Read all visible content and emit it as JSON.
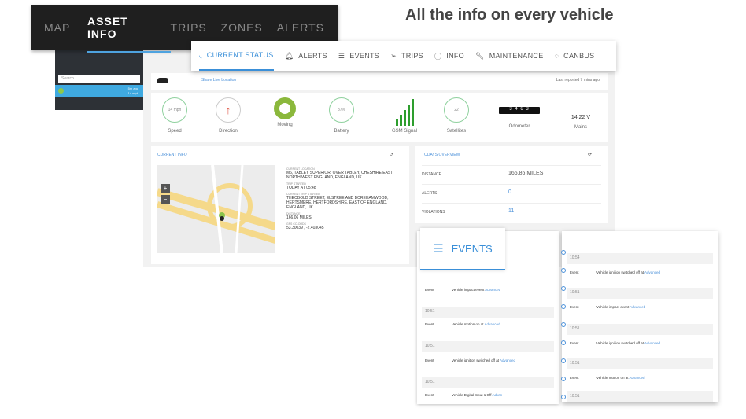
{
  "topnav": {
    "items": [
      "MAP",
      "ASSET INFO",
      "TRIPS",
      "ZONES",
      "ALERTS"
    ]
  },
  "headline": "All the info on every vehicle",
  "sidebar": {
    "search_placeholder": "Search",
    "vehicle_status": "5m ago",
    "vehicle_sub": "14 mph"
  },
  "vehicle_bar": {
    "share": "Share Live Location",
    "reported": "Last reported 7 mins ago"
  },
  "tabs": [
    {
      "label": "CURRENT STATUS",
      "icon": "signal-icon"
    },
    {
      "label": "ALERTS",
      "icon": "bell-icon"
    },
    {
      "label": "EVENTS",
      "icon": "list-icon"
    },
    {
      "label": "TRIPS",
      "icon": "navigation-icon"
    },
    {
      "label": "INFO",
      "icon": "info-icon"
    },
    {
      "label": "MAINTENANCE",
      "icon": "wrench-icon"
    },
    {
      "label": "CANBUS",
      "icon": "canbus-icon"
    }
  ],
  "gauges": {
    "speed_value": "14 mph",
    "speed_label": "Speed",
    "direction_label": "Direction",
    "moving_label": "Moving",
    "battery_value": "87%",
    "battery_label": "Battery",
    "gsm_label": "GSM Signal",
    "satellites_value": "22",
    "satellites_label": "Satellites",
    "odometer_value": "3 4 6 3",
    "odometer_label": "Odometer",
    "mains_value": "14.22 V",
    "mains_label": "Mains"
  },
  "current_info": {
    "title": "CURRENT INFO",
    "location_key": "CURRENT LOCATION",
    "location": "M6, TABLEY SUPERIOR, OVER TABLEY, CHESHIRE EAST, NORTH WEST ENGLAND, ENGLAND, UK",
    "trip_started_key": "TRIP STARTED",
    "trip_started": "TODAY AT 05:48",
    "trip_start_loc_key": "CURRENT TRIP STARTED",
    "trip_start_loc": "THEOBOLD STREET, ELSTREE AND BOREHAMWOOD, HERTSMERE, HERTFORDSHIRE, EAST OF ENGLAND, ENGLAND, UK",
    "distance_key": "DISTANCE",
    "distance": "166.06 MILES",
    "gps_key": "GPS CO-ORDS",
    "gps": "53.30039 , -2.403045"
  },
  "today": {
    "title": "TODAYS OVERVIEW",
    "rows": [
      {
        "key": "DISTANCE",
        "value": "166.86 MILES"
      },
      {
        "key": "ALERTS",
        "value": "0"
      },
      {
        "key": "VIOLATIONS",
        "value": "11"
      }
    ]
  },
  "events_tab": {
    "label": "EVENTS"
  },
  "events_left": [
    {
      "type": "row",
      "key": "Event",
      "desc": "Vehicle impact event",
      "link": "Advanced"
    },
    {
      "type": "time",
      "text": "10:51"
    },
    {
      "type": "row",
      "key": "Event",
      "desc": "Vehicle motion on at",
      "link": "Advanced"
    },
    {
      "type": "time",
      "text": "10:51"
    },
    {
      "type": "row",
      "key": "Event",
      "desc": "Vehicle ignition switched off at",
      "link": "Advanced"
    },
    {
      "type": "time",
      "text": "10:51"
    },
    {
      "type": "row",
      "key": "Event",
      "desc": "Vehicle Digital Input 1 Off",
      "link": "Advan"
    }
  ],
  "events_right": [
    {
      "type": "time",
      "text": "10:54"
    },
    {
      "type": "row",
      "key": "Event",
      "desc": "Vehicle ignition switched off at",
      "link": "Advanced"
    },
    {
      "type": "time",
      "text": "10:51"
    },
    {
      "type": "row",
      "key": "Event",
      "desc": "Vehicle impact event",
      "link": "Advanced"
    },
    {
      "type": "time",
      "text": "10:51"
    },
    {
      "type": "row",
      "key": "Event",
      "desc": "Vehicle ignition switched off at",
      "link": "Advanced"
    },
    {
      "type": "time",
      "text": "10:51"
    },
    {
      "type": "row",
      "key": "Event",
      "desc": "Vehicle motion on at",
      "link": "Advanced"
    },
    {
      "type": "time",
      "text": "10:51"
    }
  ]
}
